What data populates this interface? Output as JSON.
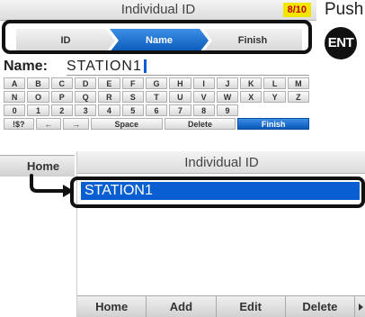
{
  "back_screen": {
    "title": "Individual ID",
    "counter": "8/10",
    "steps": [
      "ID",
      "Name",
      "Finish"
    ],
    "active_step": "Name",
    "name_label": "Name:",
    "name_value": "STATION1",
    "keyboard_rows": [
      [
        "A",
        "B",
        "C",
        "D",
        "E",
        "F",
        "G",
        "H",
        "I",
        "J",
        "K",
        "L",
        "M"
      ],
      [
        "N",
        "O",
        "P",
        "Q",
        "R",
        "S",
        "T",
        "U",
        "V",
        "W",
        "X",
        "Y",
        "Z"
      ],
      [
        "0",
        "1",
        "2",
        "3",
        "4",
        "5",
        "6",
        "7",
        "8",
        "9"
      ]
    ],
    "function_keys": [
      "!$?",
      "←",
      "→",
      "Space",
      "Delete",
      "Finish"
    ],
    "softkey_visible": "Home"
  },
  "instruction": {
    "text": "Push",
    "key_label": "ENT"
  },
  "front_screen": {
    "title": "Individual ID",
    "list_items": [
      "STATION1"
    ],
    "softkeys": [
      "Home",
      "Add",
      "Edit",
      "Delete"
    ]
  },
  "colors": {
    "accent_blue": "#0a5fd0",
    "counter_bg": "#f2e600",
    "counter_text": "#c00000"
  }
}
